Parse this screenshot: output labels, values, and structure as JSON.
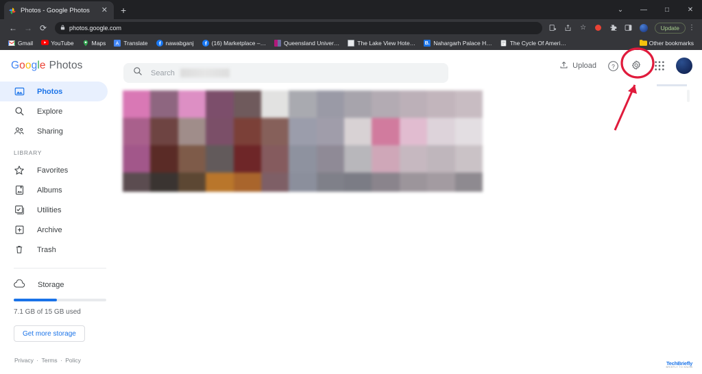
{
  "browser": {
    "tab": {
      "title": "Photos - Google Photos",
      "close_label": "✕",
      "favicon": "google-photos-favicon"
    },
    "new_tab_label": "+",
    "window_controls": [
      {
        "name": "tab-search",
        "glyph": "⌄"
      },
      {
        "name": "minimize",
        "glyph": "—"
      },
      {
        "name": "maximize",
        "glyph": "□"
      },
      {
        "name": "close",
        "glyph": "✕"
      }
    ],
    "nav": {
      "back": "←",
      "forward": "→",
      "reload": "⟳"
    },
    "omnibox": {
      "lock": "🔒",
      "url": "photos.google.com"
    },
    "toolbar_icons": [
      {
        "name": "install-app-icon",
        "glyph": "⭳"
      },
      {
        "name": "share-icon",
        "glyph": "↗"
      },
      {
        "name": "bookmark-star-icon",
        "glyph": "☆"
      },
      {
        "name": "recording-indicator-icon",
        "glyph": ""
      },
      {
        "name": "extensions-puzzle-icon",
        "glyph": "✵"
      },
      {
        "name": "side-panel-icon",
        "glyph": "▣"
      },
      {
        "name": "browser-profile-avatar",
        "glyph": ""
      }
    ],
    "update_button_label": "Update",
    "menu_label": "⋮",
    "bookmarks": [
      {
        "label": "Gmail",
        "color": "#ea4335"
      },
      {
        "label": "YouTube",
        "color": "#ff0000"
      },
      {
        "label": "Maps",
        "color": "#34a853"
      },
      {
        "label": "Translate",
        "color": "#4285f4"
      },
      {
        "label": "nawabganj",
        "color": "#1877f2"
      },
      {
        "label": "(16) Marketplace –…",
        "color": "#1877f2"
      },
      {
        "label": "Queensland Univer…",
        "color": "#b0197a"
      },
      {
        "label": "The Lake View Hote…",
        "color": "#cfd4da"
      },
      {
        "label": "Nahargarh Palace H…",
        "color": "#1a73e8"
      },
      {
        "label": "The Cycle Of Ameri…",
        "color": "#9aa0a6"
      }
    ],
    "other_bookmarks": {
      "label": "Other bookmarks",
      "color": "#f4c20d"
    }
  },
  "app_header": {
    "logo": {
      "g1": "G",
      "o1": "o",
      "o2": "o",
      "g2": "g",
      "l": "l",
      "e": "e",
      "product": "Photos"
    },
    "search": {
      "placeholder": "Search",
      "value": ""
    },
    "upload_label": "Upload",
    "help_icon": "help-circle-icon",
    "settings_icon": "gear-icon",
    "apps_icon": "apps-grid-icon",
    "account_icon": "account-avatar"
  },
  "sidebar": {
    "items": [
      {
        "label": "Photos",
        "icon": "photo-icon",
        "active": true
      },
      {
        "label": "Explore",
        "icon": "search-icon",
        "active": false
      },
      {
        "label": "Sharing",
        "icon": "people-icon",
        "active": false
      }
    ],
    "library_label": "LIBRARY",
    "library_items": [
      {
        "label": "Favorites",
        "icon": "star-icon"
      },
      {
        "label": "Albums",
        "icon": "album-icon"
      },
      {
        "label": "Utilities",
        "icon": "utilities-icon"
      },
      {
        "label": "Archive",
        "icon": "archive-icon"
      },
      {
        "label": "Trash",
        "icon": "trash-icon"
      }
    ],
    "storage": {
      "label": "Storage",
      "icon": "cloud-icon",
      "usage_text": "7.1 GB of 15 GB used",
      "used_gb": 7.1,
      "total_gb": 15,
      "percent": 47,
      "button_label": "Get more storage",
      "bar_color": "#1a73e8"
    },
    "footer": {
      "privacy": "Privacy",
      "sep1": "·",
      "terms": "Terms",
      "sep2": "·",
      "policy": "Policy"
    }
  },
  "photo_grid": {
    "description": "blurred photo thumbnails grid",
    "columns": 13,
    "rows": 4,
    "cells": [
      "#d978b5",
      "#8e6680",
      "#dd8fc4",
      "#7c4e6b",
      "#6f5a5c",
      "#e2e2e1",
      "#a9aab0",
      "#9a9aa6",
      "#a7a4ac",
      "#b3abb3",
      "#bcb0b8",
      "#c2b5bc",
      "#c8bcc2",
      "#a9608c",
      "#6e4442",
      "#a08d8a",
      "#7b4f68",
      "#7b4038",
      "#86605a",
      "#9b9dab",
      "#a09daa",
      "#d8d2d4",
      "#d17b9e",
      "#e1bcd0",
      "#ddd3da",
      "#e3dee2",
      "#a2578a",
      "#5a2b26",
      "#7e5b49",
      "#625a5b",
      "#6e2628",
      "#855b5e",
      "#8e929f",
      "#8f8a96",
      "#b8b7bb",
      "#cfa7b8",
      "#c6b8c0",
      "#bfb6bc",
      "#cac2c6",
      "#5b4c50",
      "#3a3431",
      "#5c4733",
      "#b9762b",
      "#a9652c",
      "#7e5f66",
      "#8b8f9c",
      "#7f8089",
      "#7b7c85",
      "#8a848c",
      "#9c959b",
      "#a39ba1",
      "#8e8a90"
    ]
  },
  "annotation": {
    "circle": {
      "color": "#e01b3c",
      "target": "gear-icon"
    },
    "arrow": {
      "color": "#e01b3c",
      "points_to": "settings-gear"
    }
  },
  "watermark": {
    "line1": "TechBriefly",
    "line2": "BRIEFLY TO KNOW"
  }
}
